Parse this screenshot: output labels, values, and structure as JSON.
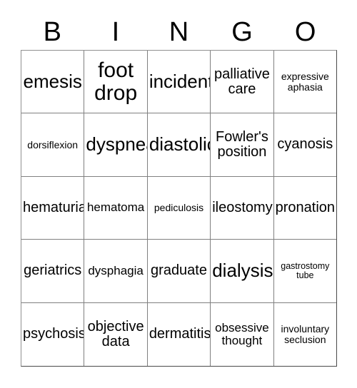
{
  "card": {
    "title": "BINGO",
    "header_letters": [
      "B",
      "I",
      "N",
      "G",
      "O"
    ],
    "colors": {
      "background": "#ffffff",
      "text": "#000000",
      "grid_line": "#808080",
      "grid_outer": "#4a4a4a"
    },
    "grid_size": "5x5",
    "rows": [
      [
        {
          "text": "emesis"
        },
        {
          "text": "foot drop"
        },
        {
          "text": "incident"
        },
        {
          "text": "palliative care"
        },
        {
          "text": "expressive aphasia"
        }
      ],
      [
        {
          "text": "dorsiflexion"
        },
        {
          "text": "dyspnea"
        },
        {
          "text": "diastolic"
        },
        {
          "text": "Fowler's position"
        },
        {
          "text": "cyanosis"
        }
      ],
      [
        {
          "text": "hematuria"
        },
        {
          "text": "hematoma"
        },
        {
          "text": "pediculosis"
        },
        {
          "text": "ileostomy"
        },
        {
          "text": "pronation"
        }
      ],
      [
        {
          "text": "geriatrics"
        },
        {
          "text": "dysphagia"
        },
        {
          "text": "graduate"
        },
        {
          "text": "dialysis"
        },
        {
          "text": "gastrostomy tube"
        }
      ],
      [
        {
          "text": "psychosis"
        },
        {
          "text": "objective data"
        },
        {
          "text": "dermatitis"
        },
        {
          "text": "obsessive thought"
        },
        {
          "text": "involuntary seclusion"
        }
      ]
    ]
  }
}
